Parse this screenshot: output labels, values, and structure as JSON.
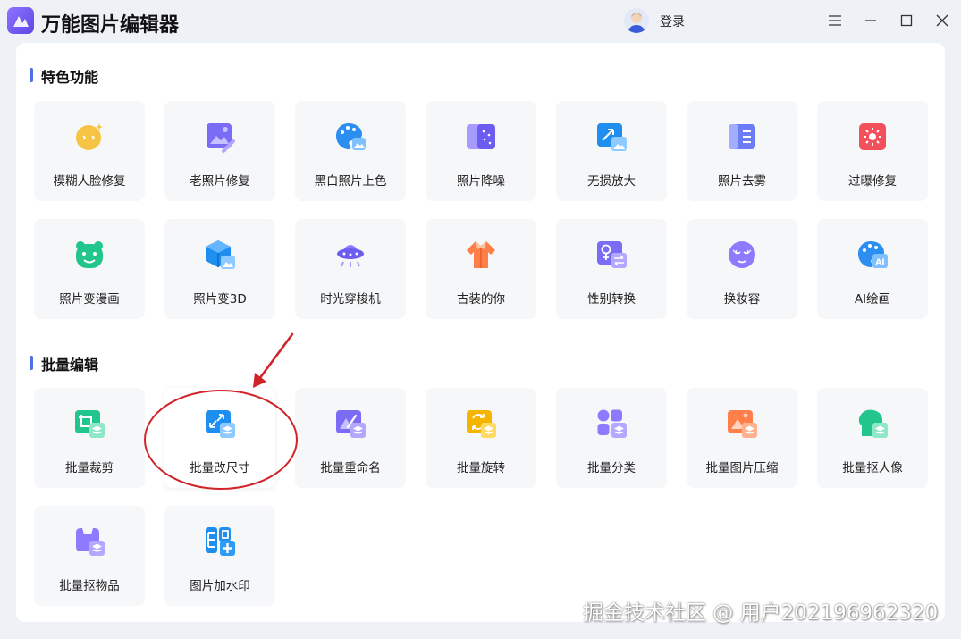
{
  "app": {
    "title": "万能图片编辑器"
  },
  "header": {
    "login_label": "登录"
  },
  "sections": {
    "featured": {
      "title": "特色功能",
      "items": [
        "模糊人脸修复",
        "老照片修复",
        "黑白照片上色",
        "照片降噪",
        "无损放大",
        "照片去雾",
        "过曝修复",
        "照片变漫画",
        "照片变3D",
        "时光穿梭机",
        "古装的你",
        "性别转换",
        "换妆容",
        "AI绘画"
      ]
    },
    "batch": {
      "title": "批量编辑",
      "items": [
        "批量裁剪",
        "批量改尺寸",
        "批量重命名",
        "批量旋转",
        "批量分类",
        "批量图片压缩",
        "批量抠人像",
        "批量抠物品",
        "图片加水印"
      ]
    }
  },
  "watermark": "掘金技术社区 @ 用户2021969623​20",
  "icons": [
    "menu-icon",
    "minimize-icon",
    "maximize-icon",
    "close-icon"
  ],
  "colors": {
    "accent": "#4f6fe8",
    "annotation": "#d0242b"
  }
}
